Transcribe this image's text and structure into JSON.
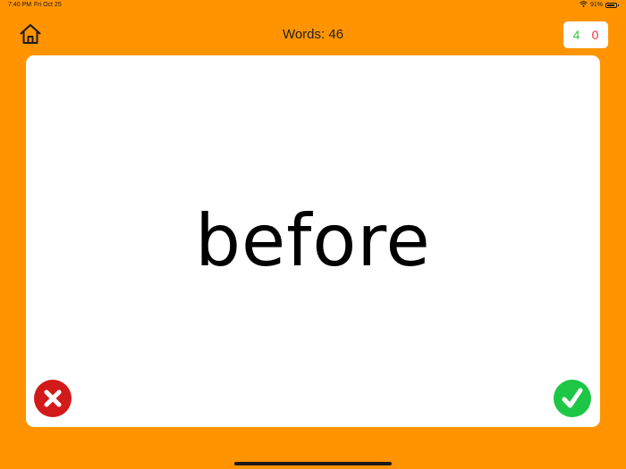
{
  "status_bar": {
    "time": "7:40 PM",
    "date": "Fri Oct 25",
    "battery": "91%",
    "icons": [
      "wifi-icon",
      "battery-icon"
    ]
  },
  "header": {
    "home_icon": "home-icon",
    "title": "Words: 46"
  },
  "score": {
    "correct": "4",
    "wrong": "0",
    "correct_color": "#2ec93c",
    "wrong_color": "#ff2b2b"
  },
  "card": {
    "word": "before",
    "wrong_icon": "x-icon",
    "right_icon": "checkmark-icon",
    "wrong_color": "#d21a1a",
    "right_color": "#1ec646"
  },
  "colors": {
    "background": "#ff9400",
    "card": "#ffffff"
  }
}
